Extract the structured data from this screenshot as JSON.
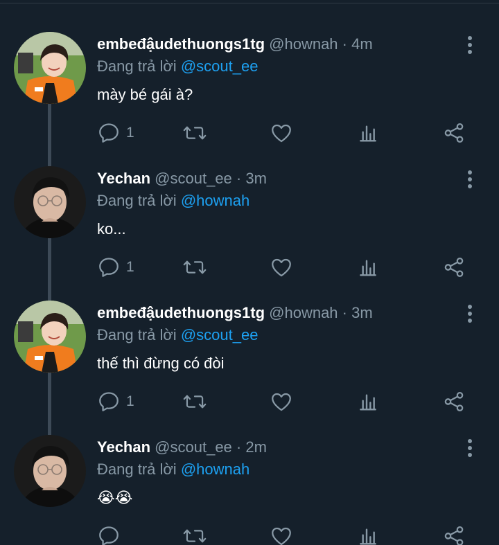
{
  "colors": {
    "background": "#15202b",
    "text_primary": "#ffffff",
    "text_secondary": "#8899a6",
    "accent": "#1da1f2",
    "thread_line": "#3d4a57"
  },
  "replying_label": "Đang trả lời",
  "tweets": [
    {
      "name": "embeđậudethuongs1tg",
      "handle": "@hownah",
      "dot": "·",
      "time": "4m",
      "reply_to": "@scout_ee",
      "text": "mày bé gái à?",
      "reply_count": "1",
      "avatar_icon": "avatar-orange-jersey"
    },
    {
      "name": "Yechan",
      "handle": "@scout_ee",
      "dot": "·",
      "time": "3m",
      "reply_to": "@hownah",
      "text": "ko...",
      "reply_count": "1",
      "avatar_icon": "avatar-glasses-dark"
    },
    {
      "name": "embeđậudethuongs1tg",
      "handle": "@hownah",
      "dot": "·",
      "time": "3m",
      "reply_to": "@scout_ee",
      "text": "thế thì đừng có đòi",
      "reply_count": "1",
      "avatar_icon": "avatar-orange-jersey"
    },
    {
      "name": "Yechan",
      "handle": "@scout_ee",
      "dot": "·",
      "time": "2m",
      "reply_to": "@hownah",
      "text": "😭😭",
      "reply_count": "",
      "avatar_icon": "avatar-glasses-dark"
    }
  ],
  "icons": {
    "reply": "reply-icon",
    "retweet": "retweet-icon",
    "like": "heart-icon",
    "analytics": "analytics-icon",
    "share": "share-icon",
    "more": "more-vertical-icon"
  }
}
